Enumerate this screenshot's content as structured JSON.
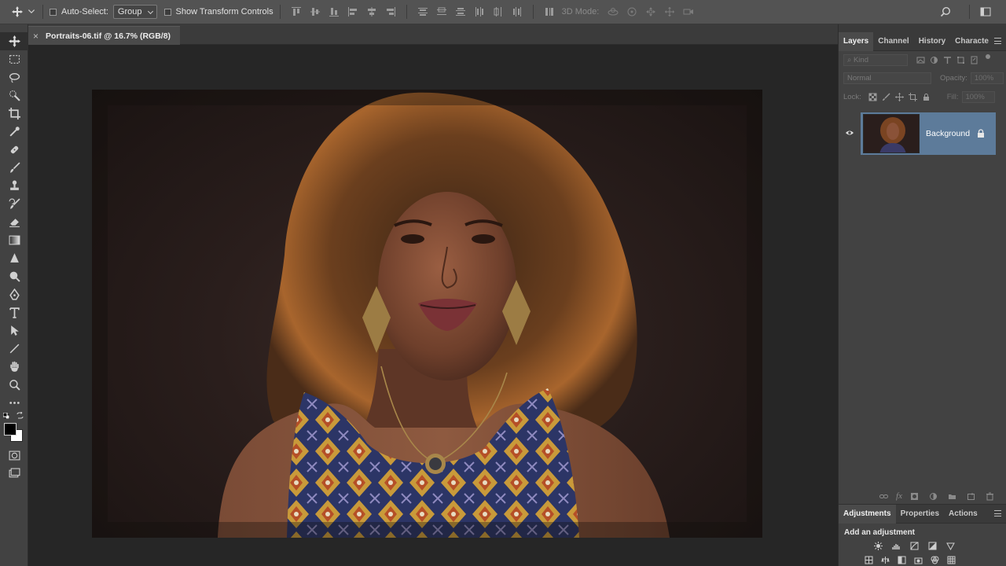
{
  "options_bar": {
    "auto_select_label": "Auto-Select:",
    "auto_select_value": "Group",
    "transform_label": "Show Transform Controls",
    "mode_3d_label": "3D Mode:"
  },
  "document": {
    "tab_title": "Portraits-06.tif @ 16.7% (RGB/8)",
    "close_glyph": "×"
  },
  "layers_panel": {
    "tabs": [
      "Layers",
      "Channel",
      "History",
      "Characte"
    ],
    "filter_placeholder": "Kind",
    "blend_mode": "Normal",
    "opacity_label": "Opacity:",
    "opacity_value": "100%",
    "lock_label": "Lock:",
    "fill_label": "Fill:",
    "fill_value": "100%",
    "layer_name": "Background",
    "footer_fx": "fx"
  },
  "adjustments_panel": {
    "tabs": [
      "Adjustments",
      "Properties",
      "Actions"
    ],
    "heading": "Add an adjustment"
  },
  "colors": {
    "accent": "#5d7b9a",
    "ui_bg": "#424242",
    "options_bg": "#535353"
  }
}
